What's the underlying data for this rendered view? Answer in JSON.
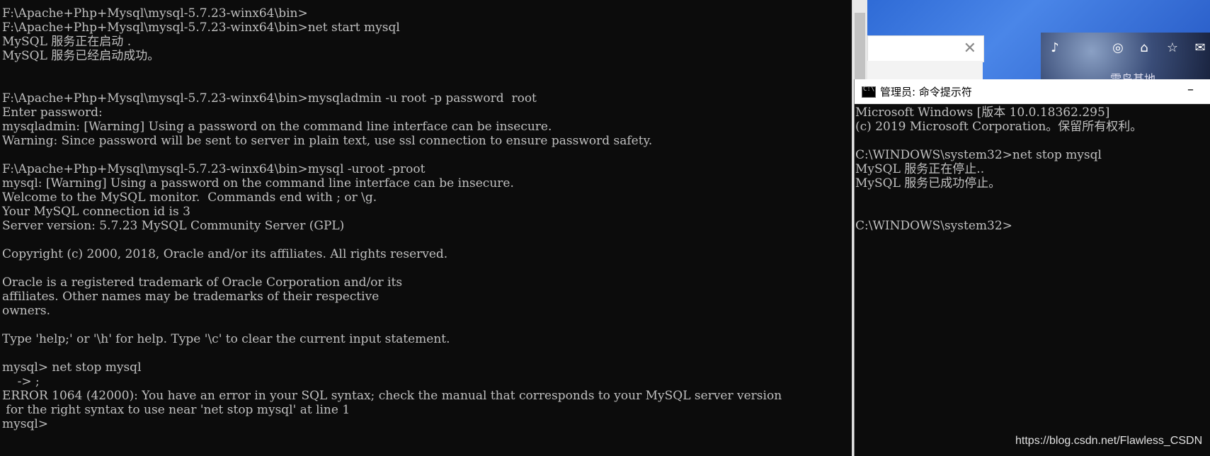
{
  "left_console": {
    "lines": [
      "F:\\Apache+Php+Mysql\\mysql-5.7.23-winx64\\bin>",
      "F:\\Apache+Php+Mysql\\mysql-5.7.23-winx64\\bin>net start mysql",
      "MySQL 服务正在启动 .",
      "MySQL 服务已经启动成功。",
      "",
      "",
      "F:\\Apache+Php+Mysql\\mysql-5.7.23-winx64\\bin>mysqladmin -u root -p password  root",
      "Enter password:",
      "mysqladmin: [Warning] Using a password on the command line interface can be insecure.",
      "Warning: Since password will be sent to server in plain text, use ssl connection to ensure password safety.",
      "",
      "F:\\Apache+Php+Mysql\\mysql-5.7.23-winx64\\bin>mysql -uroot -proot",
      "mysql: [Warning] Using a password on the command line interface can be insecure.",
      "Welcome to the MySQL monitor.  Commands end with ; or \\g.",
      "Your MySQL connection id is 3",
      "Server version: 5.7.23 MySQL Community Server (GPL)",
      "",
      "Copyright (c) 2000, 2018, Oracle and/or its affiliates. All rights reserved.",
      "",
      "Oracle is a registered trademark of Oracle Corporation and/or its",
      "affiliates. Other names may be trademarks of their respective",
      "owners.",
      "",
      "Type 'help;' or '\\h' for help. Type '\\c' to clear the current input statement.",
      "",
      "mysql> net stop mysql",
      "    -> ;",
      "ERROR 1064 (42000): You have an error in your SQL syntax; check the manual that corresponds to your MySQL server version",
      " for the right syntax to use near 'net stop mysql' at line 1",
      "mysql>"
    ]
  },
  "cmd_window": {
    "title": "管理员: 命令提示符",
    "icon_label": "C:\\",
    "minimize": "–",
    "lines": [
      "Microsoft Windows [版本 10.0.18362.295]",
      "(c) 2019 Microsoft Corporation。保留所有权利。",
      "",
      "C:\\WINDOWS\\system32>net stop mysql",
      "MySQL 服务正在停止..",
      "MySQL 服务已成功停止。",
      "",
      "",
      "C:\\WINDOWS\\system32>"
    ]
  },
  "background_app": {
    "close_glyph": "✕",
    "caption": "雷鸟基地",
    "icons": [
      "bell-icon",
      "medal-icon",
      "shirt-icon",
      "star-icon",
      "mail-icon"
    ]
  },
  "watermark": "https://blog.csdn.net/Flawless_CSDN",
  "colors": {
    "console_bg": "#0c0c0c",
    "console_text": "#c0c0c0",
    "titlebar_bg": "#ffffff"
  }
}
